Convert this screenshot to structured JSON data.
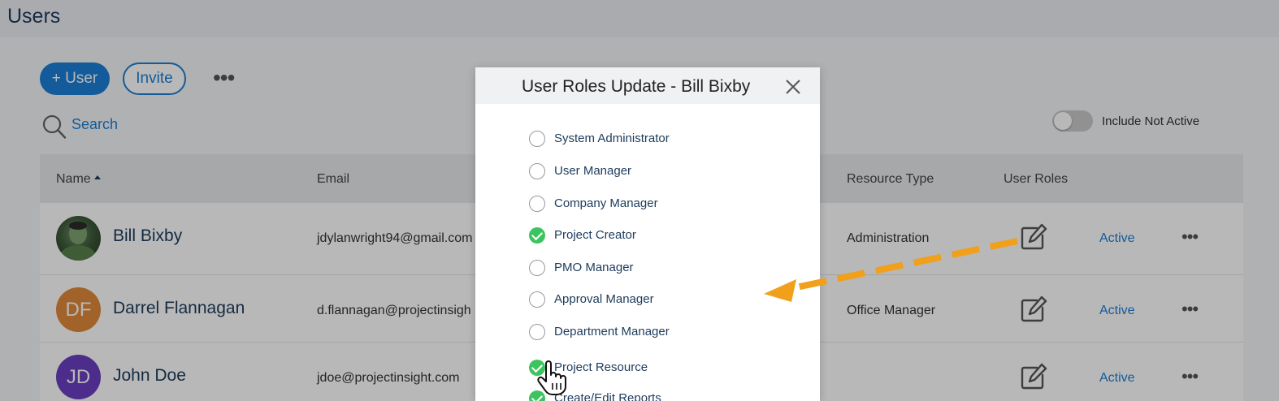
{
  "page": {
    "title": "Users"
  },
  "toolbar": {
    "add_user_label": "+ User",
    "invite_label": "Invite",
    "more_label": "•••"
  },
  "search": {
    "placeholder": "Search"
  },
  "filter": {
    "include_not_active_label": "Include Not Active",
    "include_not_active_on": false
  },
  "table": {
    "columns": {
      "name": "Name",
      "email": "Email",
      "resource_type": "Resource Type",
      "user_roles": "User Roles"
    },
    "rows": [
      {
        "name": "Bill Bixby",
        "initials": "",
        "avatar": "photo",
        "avatar_color": "#3e5a3b",
        "email": "jdylanwright94@gmail.com",
        "resource_type": "Administration",
        "status": "Active",
        "more": "•••"
      },
      {
        "name": "Darrel Flannagan",
        "initials": "DF",
        "avatar": "initials",
        "avatar_color": "#e0893a",
        "email": "d.flannagan@projectinsigh",
        "resource_type": "Office Manager",
        "status": "Active",
        "more": "•••"
      },
      {
        "name": "John Doe",
        "initials": "JD",
        "avatar": "initials",
        "avatar_color": "#6a3fc2",
        "email": "jdoe@projectinsight.com",
        "resource_type": "",
        "status": "Active",
        "more": "•••"
      }
    ]
  },
  "modal": {
    "title": "User Roles Update - Bill Bixby",
    "roles": [
      {
        "label": "System Administrator",
        "checked": false
      },
      {
        "label": "User Manager",
        "checked": false
      },
      {
        "label": "Company Manager",
        "checked": false
      },
      {
        "label": "Project Creator",
        "checked": true
      },
      {
        "label": "PMO Manager",
        "checked": false
      },
      {
        "label": "Approval Manager",
        "checked": false
      },
      {
        "label": "Department Manager",
        "checked": false
      },
      {
        "label": "Project Resource",
        "checked": true
      },
      {
        "label": "Create/Edit Reports",
        "checked": true
      }
    ]
  },
  "colors": {
    "primary": "#1b7fd6",
    "checked": "#3dc461",
    "annotation_arrow": "#f0a01a",
    "title": "#1d3b5c"
  },
  "icons": {
    "search": "search-icon",
    "edit": "edit-icon",
    "close": "close-icon",
    "cursor": "hand-pointer-icon"
  }
}
